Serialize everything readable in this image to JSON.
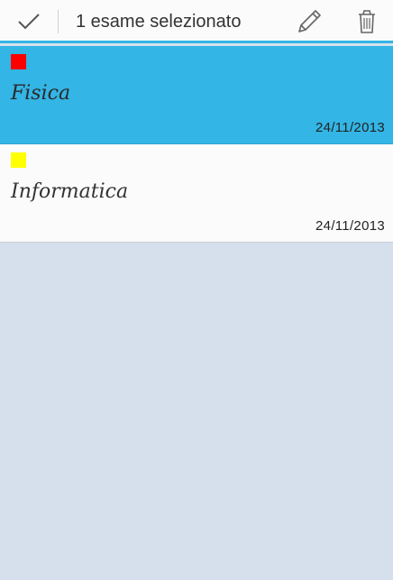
{
  "action_bar": {
    "title": "1 esame selezionato",
    "done_icon": "checkmark-icon",
    "edit_icon": "pencil-icon",
    "delete_icon": "trash-icon",
    "accent_color": "#33b5e5"
  },
  "exams": [
    {
      "name": "Fisica",
      "date": "24/11/2013",
      "color": "#ff0000",
      "selected": true
    },
    {
      "name": "Informatica",
      "date": "24/11/2013",
      "color": "#ffff00",
      "selected": false
    }
  ],
  "colors": {
    "selected_background": "#33b5e5",
    "page_background": "#d5e0ec"
  }
}
